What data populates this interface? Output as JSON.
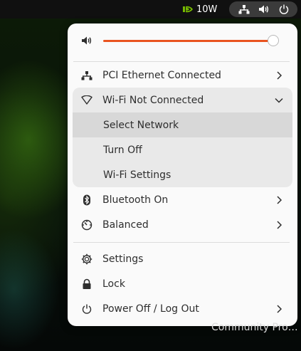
{
  "topbar": {
    "gpu_power": "10W",
    "icons": [
      "nvidia-logo",
      "network-wired-icon",
      "volume-icon",
      "power-icon"
    ]
  },
  "menu": {
    "volume": {
      "level": 0.97
    },
    "ethernet": {
      "label": "PCI Ethernet Connected",
      "icon": "network-wired-icon"
    },
    "wifi": {
      "label": "Wi-Fi Not Connected",
      "icon": "wifi-outline-icon",
      "submenu": [
        "Select Network",
        "Turn Off",
        "Wi-Fi Settings"
      ]
    },
    "bluetooth": {
      "label": "Bluetooth On",
      "icon": "bluetooth-icon"
    },
    "power_mode": {
      "label": "Balanced",
      "icon": "speedometer-icon"
    },
    "settings": {
      "label": "Settings",
      "icon": "gear-icon"
    },
    "lock": {
      "label": "Lock",
      "icon": "lock-icon"
    },
    "power_off": {
      "label": "Power Off / Log Out",
      "icon": "power-icon"
    }
  },
  "desktop": {
    "partial_label": "Community Pro…"
  },
  "colors": {
    "accent": "#e95420",
    "menu_bg": "#fafafa",
    "submenu_bg": "#e9e9e9",
    "topbar_bg": "#101010"
  }
}
